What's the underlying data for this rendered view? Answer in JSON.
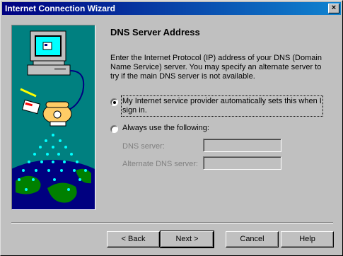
{
  "window": {
    "title": "Internet Connection Wizard",
    "close_glyph": "×"
  },
  "page": {
    "heading": "DNS Server Address",
    "description": "Enter the Internet Protocol (IP) address of your DNS (Domain Name Service) server.  You may specify an alternate server to try if the main DNS server is not available."
  },
  "options": {
    "auto": {
      "label_line1": "My Internet service provider automatically sets this when I",
      "label_line2": "sign in.",
      "checked": true
    },
    "manual": {
      "label": "Always use the following:",
      "checked": false
    }
  },
  "fields": {
    "dns_label": "DNS server:",
    "alt_dns_label": "Alternate DNS server:",
    "dns_value": "",
    "alt_dns_value": ""
  },
  "buttons": {
    "back": "< Back",
    "next": "Next >",
    "cancel": "Cancel",
    "help": "Help"
  }
}
